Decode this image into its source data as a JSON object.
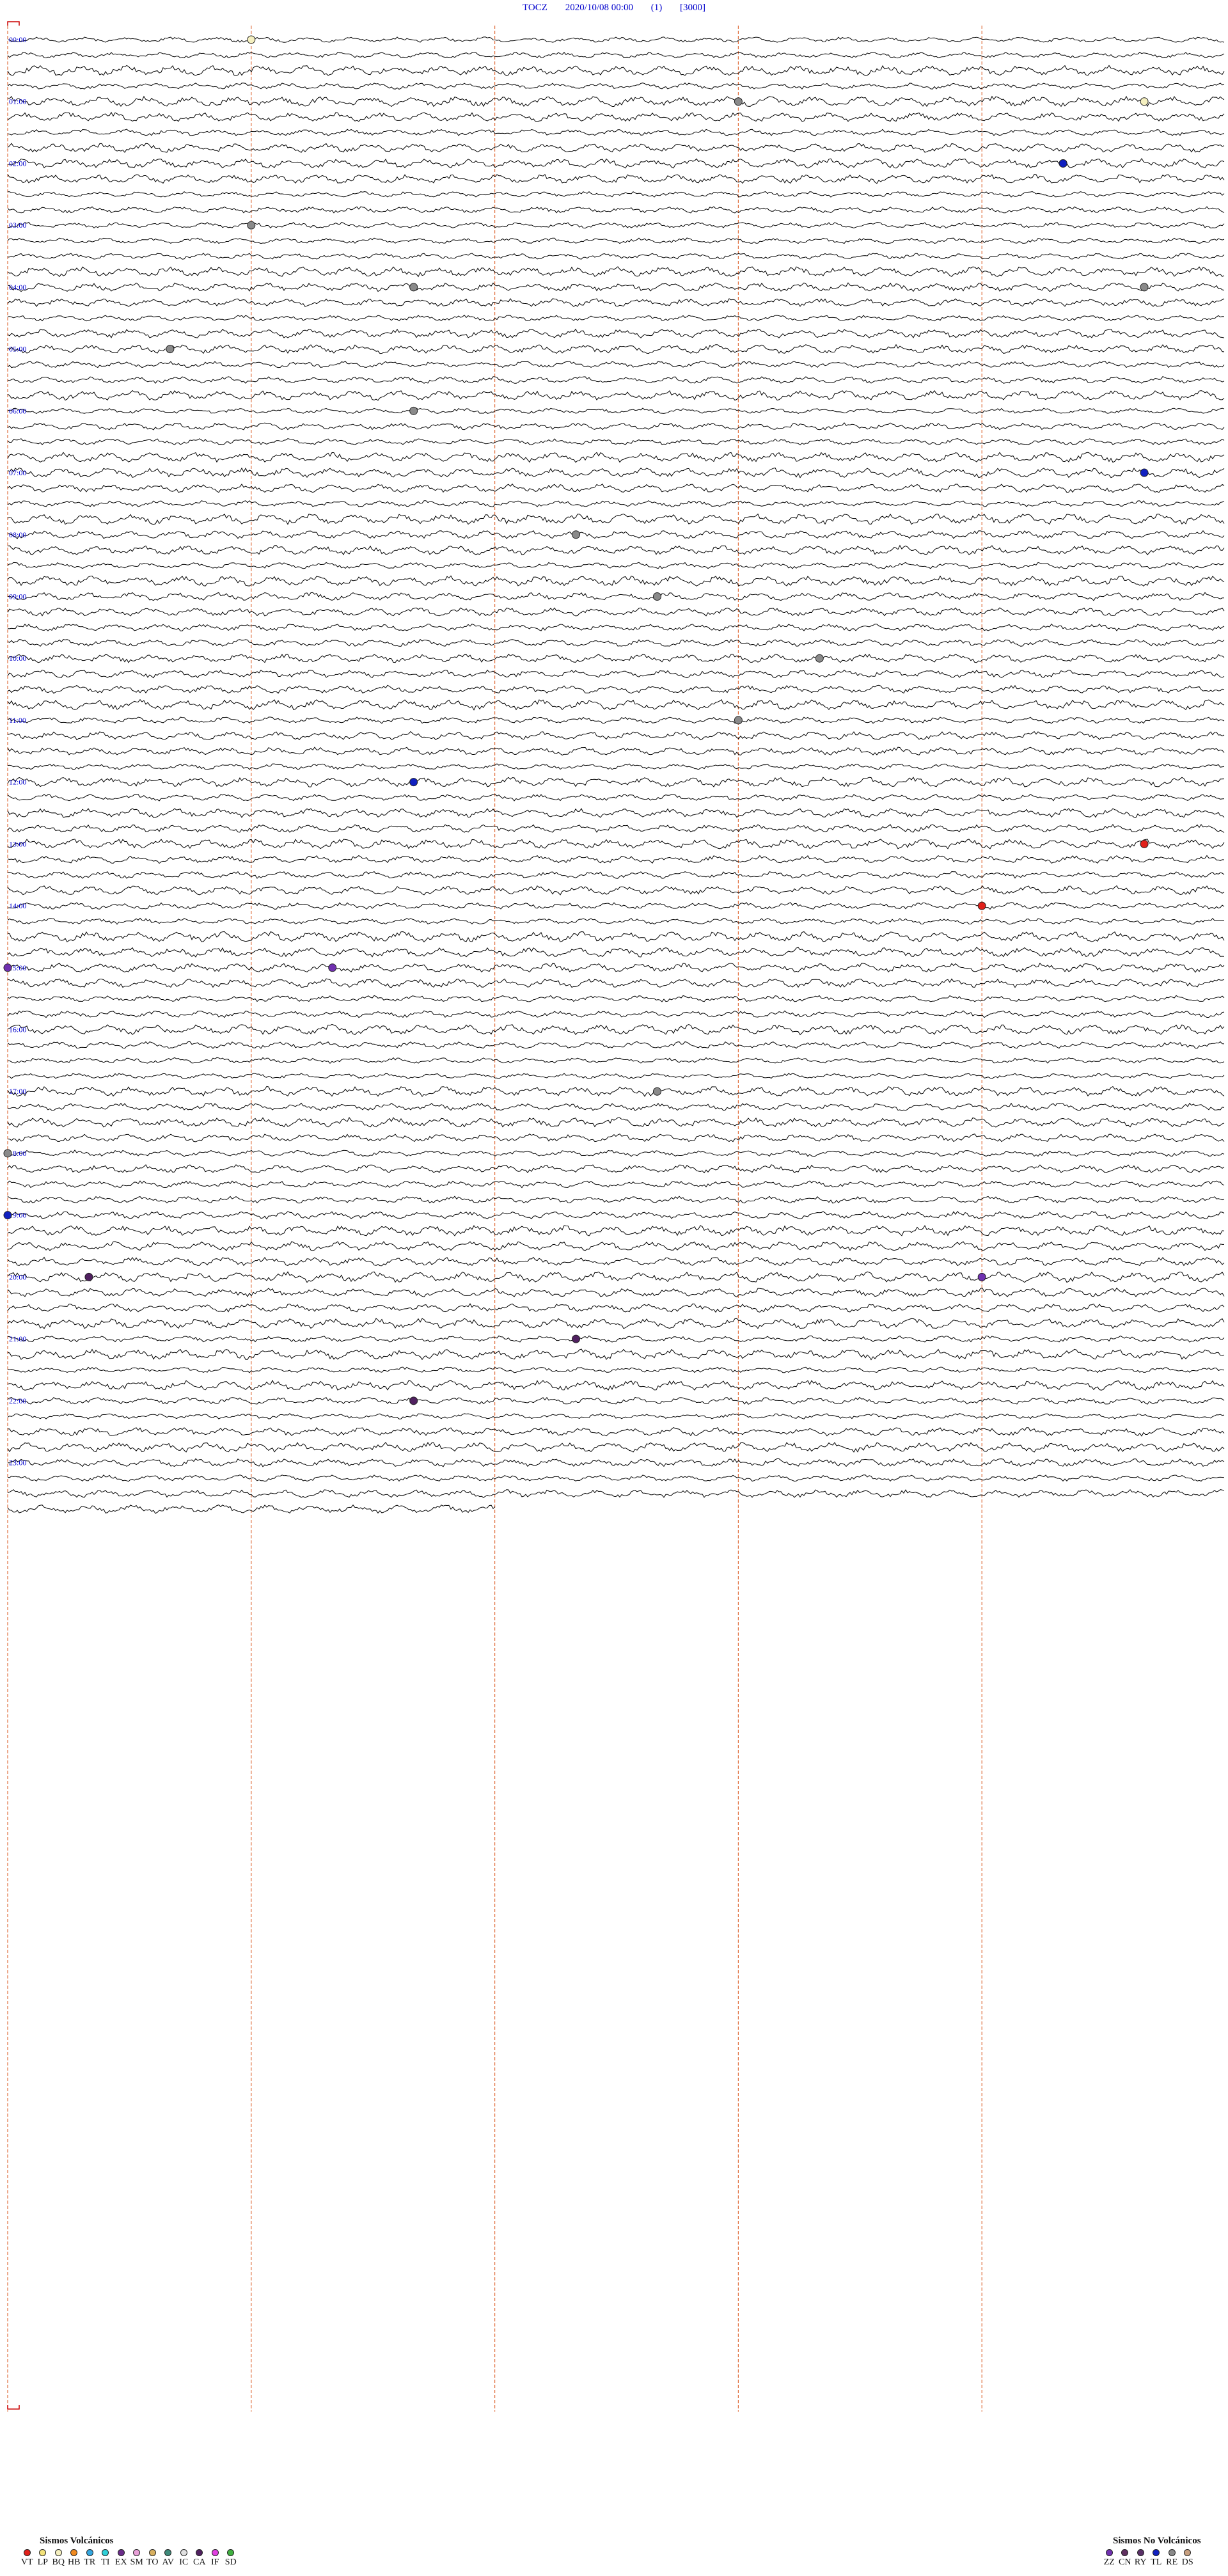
{
  "header": {
    "station": "TOCZ",
    "datetime": "2020/10/08 00:00",
    "channel": "(1)",
    "scale": "[3000]"
  },
  "colors": {
    "trace": "#000000",
    "minute_marker": "#e07040",
    "label": "#0000cc",
    "frame_marker": "#cc0000"
  },
  "hour_labels": [
    {
      "row": 0,
      "text": "00:00"
    },
    {
      "row": 4,
      "text": "01:00"
    },
    {
      "row": 8,
      "text": "02:00"
    },
    {
      "row": 12,
      "text": "03:00"
    },
    {
      "row": 16,
      "text": "04:00"
    },
    {
      "row": 20,
      "text": "05:00"
    },
    {
      "row": 24,
      "text": "06:00"
    },
    {
      "row": 28,
      "text": "07:00"
    },
    {
      "row": 32,
      "text": "08:00"
    },
    {
      "row": 36,
      "text": "09:00"
    },
    {
      "row": 40,
      "text": "10:00"
    },
    {
      "row": 44,
      "text": "11:00"
    },
    {
      "row": 48,
      "text": "12:00"
    },
    {
      "row": 52,
      "text": "13:00"
    },
    {
      "row": 56,
      "text": "14:00"
    },
    {
      "row": 60,
      "text": "15:00"
    },
    {
      "row": 64,
      "text": "16:00"
    },
    {
      "row": 68,
      "text": "17:00"
    },
    {
      "row": 72,
      "text": "18:00"
    },
    {
      "row": 76,
      "text": "19:00"
    },
    {
      "row": 80,
      "text": "20:00"
    },
    {
      "row": 84,
      "text": "21:00"
    },
    {
      "row": 88,
      "text": "22:00"
    },
    {
      "row": 92,
      "text": "23:00"
    }
  ],
  "legend": {
    "volcanic_title": "Sismos Volcánicos",
    "volcanic": [
      {
        "code": "VT",
        "color": "#e0201a"
      },
      {
        "code": "LP",
        "color": "#f3e27a"
      },
      {
        "code": "BQ",
        "color": "#f5f0c0"
      },
      {
        "code": "HB",
        "color": "#f08a20"
      },
      {
        "code": "TR",
        "color": "#34a7e0"
      },
      {
        "code": "TI",
        "color": "#30d0d8"
      },
      {
        "code": "EX",
        "color": "#6a2c8a"
      },
      {
        "code": "SM",
        "color": "#e8a0d8"
      },
      {
        "code": "TO",
        "color": "#d8b060"
      },
      {
        "code": "AV",
        "color": "#3e8a7a"
      },
      {
        "code": "IC",
        "color": "#e0e0e0"
      },
      {
        "code": "CA",
        "color": "#502060"
      },
      {
        "code": "IF",
        "color": "#e040e0"
      },
      {
        "code": "SD",
        "color": "#40b040"
      }
    ],
    "nonvolcanic_title": "Sismos No Volcánicos",
    "nonvolcanic": [
      {
        "code": "ZZ",
        "color": "#7030b0"
      },
      {
        "code": "CN",
        "color": "#603060"
      },
      {
        "code": "RY",
        "color": "#5a3068"
      },
      {
        "code": "TL",
        "color": "#1020c0"
      },
      {
        "code": "RE",
        "color": "#8a8a8a"
      },
      {
        "code": "DS",
        "color": "#c8a080"
      }
    ]
  },
  "chart_data": {
    "type": "line",
    "title": "",
    "xlabel": "",
    "ylabel": "",
    "rows_per_hour": 4,
    "minutes_per_row": 15,
    "hours": 24,
    "minute_markers": [
      0,
      3,
      6,
      9,
      12
    ],
    "events": [
      {
        "hour": 0,
        "minute": 3,
        "type": "BQ"
      },
      {
        "hour": 1,
        "minute": 9,
        "type": "RE"
      },
      {
        "hour": 1,
        "minute": 14,
        "type": "BQ"
      },
      {
        "hour": 2,
        "minute": 13,
        "type": "RE"
      },
      {
        "hour": 2,
        "minute": 13,
        "type": "TL"
      },
      {
        "hour": 3,
        "minute": 3,
        "type": "RE"
      },
      {
        "hour": 4,
        "minute": 5,
        "type": "RE"
      },
      {
        "hour": 4,
        "minute": 14,
        "type": "RE"
      },
      {
        "hour": 5,
        "minute": 2,
        "type": "RE"
      },
      {
        "hour": 6,
        "minute": 5,
        "type": "RE"
      },
      {
        "hour": 7,
        "minute": 14,
        "type": "TL"
      },
      {
        "hour": 8,
        "minute": 7,
        "type": "RE"
      },
      {
        "hour": 9,
        "minute": 8,
        "type": "RE"
      },
      {
        "hour": 10,
        "minute": 10,
        "type": "RE"
      },
      {
        "hour": 11,
        "minute": 9,
        "type": "RE"
      },
      {
        "hour": 12,
        "minute": 5,
        "type": "TL"
      },
      {
        "hour": 13,
        "minute": 14,
        "type": "VT"
      },
      {
        "hour": 14,
        "minute": 12,
        "type": "VT"
      },
      {
        "hour": 15,
        "minute": 0,
        "type": "ZZ"
      },
      {
        "hour": 15,
        "minute": 4,
        "type": "ZZ"
      },
      {
        "hour": 17,
        "minute": 8,
        "type": "RE"
      },
      {
        "hour": 18,
        "minute": 0,
        "type": "RE"
      },
      {
        "hour": 19,
        "minute": 0,
        "type": "TL"
      },
      {
        "hour": 20,
        "minute": 1,
        "type": "CA"
      },
      {
        "hour": 20,
        "minute": 12,
        "type": "ZZ"
      },
      {
        "hour": 21,
        "minute": 7,
        "type": "CA"
      },
      {
        "hour": 22,
        "minute": 5,
        "type": "CA"
      }
    ]
  }
}
